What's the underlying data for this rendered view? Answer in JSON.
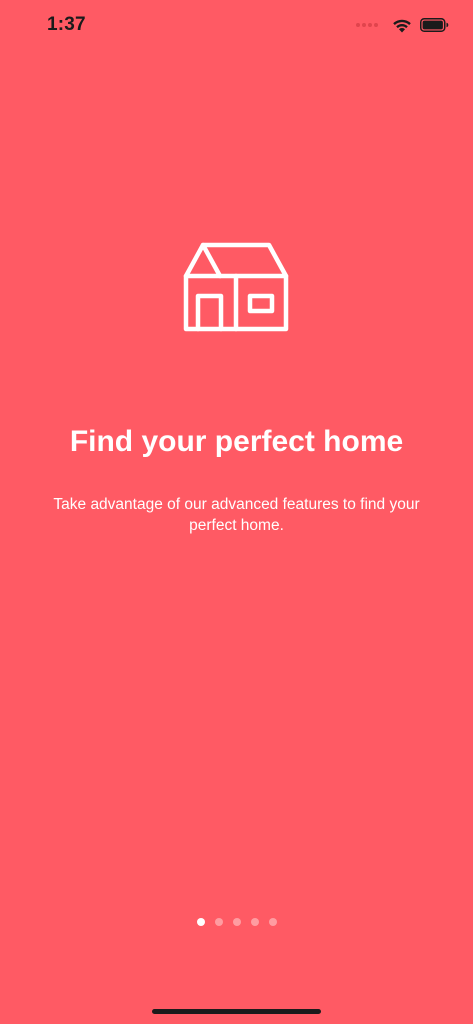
{
  "colors": {
    "background": "#ff5a64",
    "foreground": "#ffffff",
    "status_text": "#1b1b1b",
    "dot_active": "#ffffff",
    "dot_inactive": "#ff9ca1",
    "home_indicator": "#1b1b1b"
  },
  "status_bar": {
    "time": "1:37",
    "signal_icon": "cellular-dots-icon",
    "wifi_icon": "wifi-icon",
    "battery_icon": "battery-icon"
  },
  "hero": {
    "icon": "house-icon"
  },
  "content": {
    "title": "Find your perfect home",
    "description": "Take advantage of our advanced features to find your perfect home."
  },
  "pagination": {
    "total_pages": 5,
    "current_page": 1
  }
}
